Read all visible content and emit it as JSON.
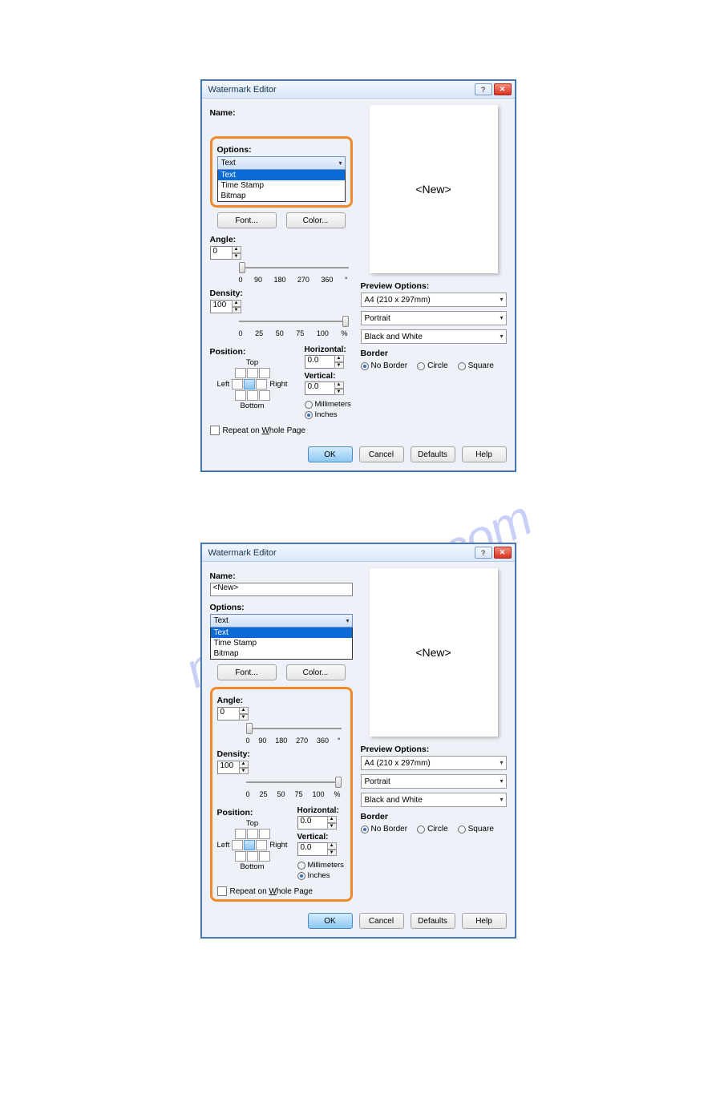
{
  "dialog": {
    "title": "Watermark Editor",
    "name_label": "Name:",
    "name_value": "<New>",
    "options_label": "Options:",
    "combo_value": "Text",
    "dropdown": [
      "Text",
      "Time Stamp",
      "Bitmap"
    ],
    "font_btn": "Font...",
    "color_btn": "Color...",
    "angle_label": "Angle:",
    "angle_value": "0",
    "angle_ticks": [
      "0",
      "90",
      "180",
      "270",
      "360",
      "°"
    ],
    "density_label": "Density:",
    "density_value": "100",
    "density_ticks": [
      "0",
      "25",
      "50",
      "75",
      "100",
      "%"
    ],
    "position_label": "Position:",
    "top": "Top",
    "left": "Left",
    "right": "Right",
    "bottom": "Bottom",
    "horizontal": "Horizontal:",
    "vertical": "Vertical:",
    "hv_value": "0.0",
    "units_mm": "Millimeters",
    "units_in": "Inches",
    "repeat": "Repeat on Whole Page",
    "repeat_u": "W",
    "preview_text": "<New>",
    "preview_opts": "Preview Options:",
    "paper": "A4 (210 x 297mm)",
    "orient": "Portrait",
    "color_mode": "Black and White",
    "border_label": "Border",
    "border_opts": [
      "No Border",
      "Circle",
      "Square"
    ],
    "ok": "OK",
    "cancel": "Cancel",
    "defaults": "Defaults",
    "help": "Help"
  },
  "watermark_text": "manualshive.com"
}
